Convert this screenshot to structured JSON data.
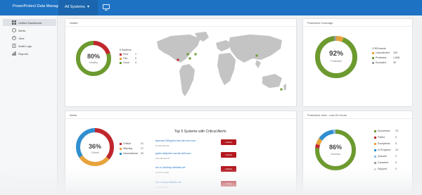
{
  "header": {
    "app_title": "PowerProtect Data Manager",
    "system_menu": "All Systems"
  },
  "sidebar": {
    "items": [
      {
        "label": "Unified Dashboard",
        "icon": "dashboard-icon"
      },
      {
        "label": "Alerts",
        "icon": "alert-icon"
      },
      {
        "label": "Jobs",
        "icon": "jobs-icon"
      },
      {
        "label": "Audit Logs",
        "icon": "audit-log-icon"
      },
      {
        "label": "Reports",
        "icon": "reports-icon"
      }
    ]
  },
  "health": {
    "title": "Health",
    "percent": "80%",
    "status": "Healthy",
    "systems_label": "6 Systems",
    "legend": [
      {
        "label": "Poor",
        "count": "1",
        "color": "#c0272d"
      },
      {
        "label": "Fair",
        "count": "0",
        "color": "#e8a33c"
      },
      {
        "label": "Good",
        "count": "4",
        "color": "#6d9a2f"
      }
    ]
  },
  "protection_coverage": {
    "title": "Protection Coverage",
    "percent": "92%",
    "status": "Protected",
    "assets_label": "1765 Assets",
    "legend": [
      {
        "label": "Unprotected",
        "count": "100",
        "color": "#e8a33c"
      },
      {
        "label": "Protected",
        "count": "1,608",
        "color": "#6d9a2f"
      },
      {
        "label": "Excluded",
        "count": "30",
        "color": "#9e9e9e"
      }
    ]
  },
  "alerts": {
    "title": "Alerts",
    "percent": "36%",
    "status": "Critical",
    "legend": [
      {
        "label": "Critical",
        "count": "21",
        "color": "#c0272d"
      },
      {
        "label": "Warning",
        "count": "17",
        "color": "#e8a33c"
      },
      {
        "label": "Informational",
        "count": "20",
        "color": "#2f8fd0"
      }
    ],
    "top_title": "Top 5 Systems with Critical Alerts",
    "rows": [
      {
        "host": "dpmvas-252ppdm.drm.lab.emc.com",
        "ip": "10.201.200.23",
        "badge": "Critical"
      },
      {
        "host": "ppdm.daily.drm.rsa.lab.dell.com",
        "ip": "192.168.108.37",
        "badge": "Critical"
      },
      {
        "host": "rdr-m-2dcdhcp.delllabs.net",
        "ip": "10.247.11.180",
        "badge": "Critical"
      },
      {
        "host": "rdr-m-dhcp.delllabs.net",
        "ip": "10.247.11.180",
        "badge": "Critical"
      }
    ]
  },
  "jobs": {
    "title": "Protection Jobs - Last 24 Hours",
    "percent": "86%",
    "status": "Success",
    "legend": [
      {
        "label": "Successful",
        "count": "75",
        "color": "#6d9a2f"
      },
      {
        "label": "Failed",
        "count": "3",
        "color": "#c0272d"
      },
      {
        "label": "Exceptions",
        "count": "5",
        "color": "#e8a33c"
      },
      {
        "label": "In Progress",
        "count": "13",
        "color": "#2f8fd0"
      },
      {
        "label": "Queued",
        "count": "2",
        "color": "#8fbde3"
      },
      {
        "label": "Canceled",
        "count": "0",
        "color": "#9e9e9e"
      },
      {
        "label": "Skipped",
        "count": "0",
        "color": "#d6d6d6"
      }
    ]
  }
}
